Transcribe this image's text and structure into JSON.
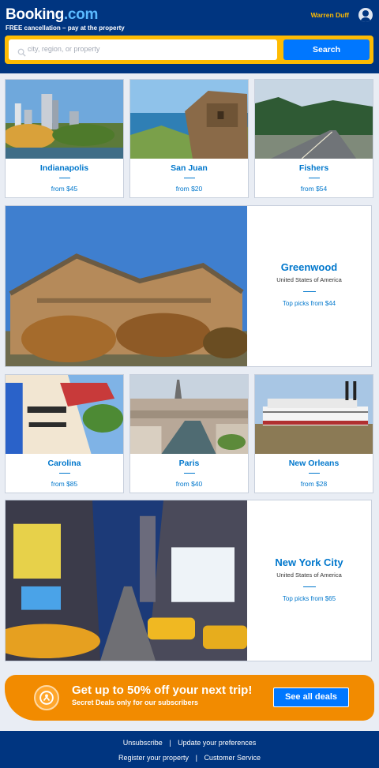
{
  "header": {
    "logo_main": "Booking",
    "logo_suffix": ".com",
    "tagline": "FREE cancellation – pay at the property",
    "user_name": "Warren Duff"
  },
  "search": {
    "placeholder": "city, region, or property",
    "button_label": "Search"
  },
  "row1": [
    {
      "city": "Indianapolis",
      "price": "from $45"
    },
    {
      "city": "San Juan",
      "price": "from $20"
    },
    {
      "city": "Fishers",
      "price": "from $54"
    }
  ],
  "feature1": {
    "city": "Greenwood",
    "country": "United States of America",
    "price": "Top picks from $44"
  },
  "row2": [
    {
      "city": "Carolina",
      "price": "from $85"
    },
    {
      "city": "Paris",
      "price": "from $40"
    },
    {
      "city": "New Orleans",
      "price": "from $28"
    }
  ],
  "feature2": {
    "city": "New York City",
    "country": "United States of America",
    "price": "Top picks from $65"
  },
  "promo": {
    "title": "Get up to 50% off your next trip!",
    "subtitle": "Secret Deals only for our subscribers",
    "button_label": "See all deals"
  },
  "footer": {
    "unsubscribe": "Unsubscribe",
    "preferences": "Update your preferences",
    "register": "Register your property",
    "customer_service": "Customer Service",
    "separator": "|"
  },
  "colors": {
    "brand_blue": "#003580",
    "accent_yellow": "#febb02",
    "action_blue": "#0077ff",
    "link_blue": "#0077cc",
    "promo_orange": "#f28b00"
  }
}
